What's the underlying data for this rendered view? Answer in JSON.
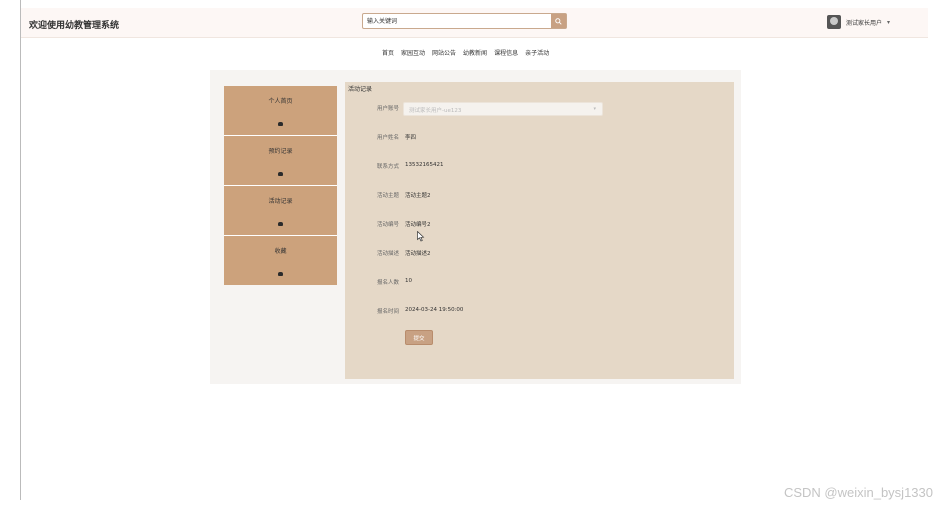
{
  "header": {
    "site_title": "欢迎使用幼教管理系统",
    "search_placeholder": "输入关键词",
    "user_name": "测试家长用户",
    "caret": "▾"
  },
  "nav": {
    "items": [
      "首页",
      "家园互动",
      "网站公告",
      "幼教新闻",
      "课程信息",
      "亲子活动"
    ]
  },
  "sidebar": {
    "items": [
      {
        "label": "个人首页"
      },
      {
        "label": "预约记录"
      },
      {
        "label": "活动记录"
      },
      {
        "label": "收藏"
      }
    ]
  },
  "form": {
    "title": "活动记录",
    "fields": [
      {
        "label": "用户账号",
        "value": "测试家长用户-ue123"
      },
      {
        "label": "用户姓名",
        "value": "李四"
      },
      {
        "label": "联系方式",
        "value": "13532165421"
      },
      {
        "label": "活动主题",
        "value": "活动主题2"
      },
      {
        "label": "活动编号",
        "value": "活动编号2"
      },
      {
        "label": "活动描述",
        "value": "活动描述2"
      },
      {
        "label": "报名人数",
        "value": "10"
      },
      {
        "label": "报名时间",
        "value": "2024-03-24 19:50:00"
      }
    ],
    "submit_label": "提交"
  },
  "watermark": "CSDN @weixin_bysj1330",
  "colors": {
    "accent": "#c8a183",
    "sidebar": "#cca27c",
    "content_bg": "#e5d8c7"
  }
}
